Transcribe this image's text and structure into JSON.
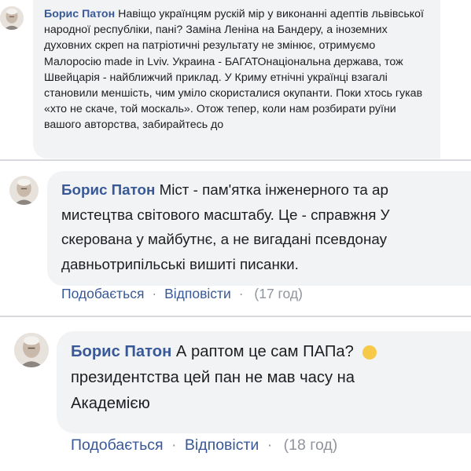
{
  "comments": [
    {
      "author": "Борис Патон",
      "text": "Навіщо українцям рускій мір у виконанні адептів львівської народної республіки, пані? Заміна Леніна на Бандеру, а іноземних духовних скреп на патріотичні результату не змінює, отримуємо Малоросію made in Lviv. Украина - БАГАТОнаціональна держава, тож Швейцарія - найближчий приклад. У Криму етнічні українці взагалі становили меншість, чим уміло скористалися окупанти. Поки хтось гукав «хто не скаче, той москаль». Отож тепер, коли нам розбирати руїни вашого авторства, забирайтесь до"
    },
    {
      "author": "Борис Патон",
      "lines": [
        "Міст - пам'ятка інженерного та ар",
        "мистецтва світового масштабу. Це - справжня У",
        "скерована у майбутнє, а не вигадані псевдонау",
        "давньотрипільські вишиті писанки."
      ],
      "actions": {
        "like": "Подобається",
        "reply": "Відповісти",
        "separator": "·",
        "time": "(17 год)"
      }
    },
    {
      "author": "Борис Патон",
      "lines": [
        "А раптом це сам ПАПа?",
        "президентства цей пан не мав часу на",
        "Академією"
      ],
      "actions": {
        "like": "Подобається",
        "reply": "Відповісти",
        "separator": "·",
        "time": "(18 год)"
      }
    }
  ],
  "icons": {
    "avatar": "profile-photo-elderly-man",
    "emoji": "emoji-face-icon"
  },
  "colors": {
    "name": "#385898",
    "bubble": "#f2f3f5",
    "link": "#385898",
    "meta": "#90949c"
  }
}
